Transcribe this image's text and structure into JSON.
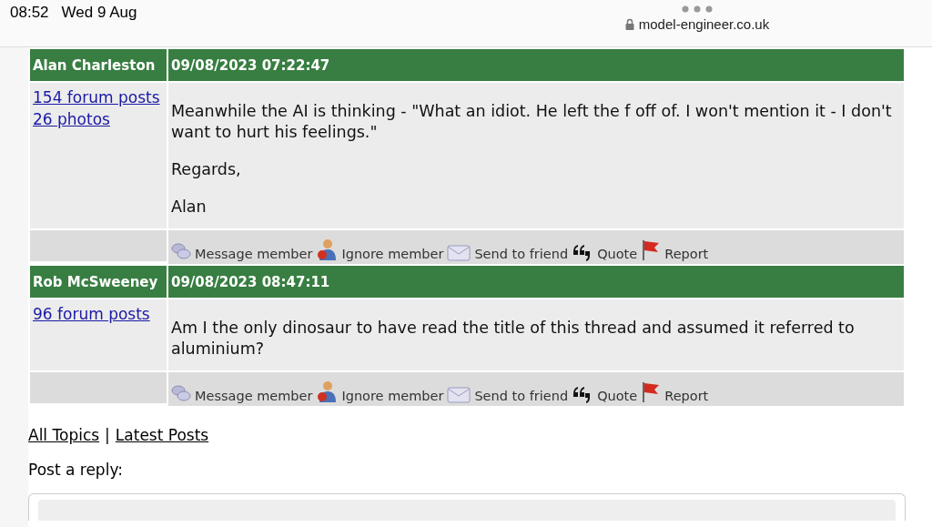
{
  "status_bar": {
    "time": "08:52",
    "date": "Wed 9 Aug"
  },
  "address_bar": {
    "url": "model-engineer.co.uk"
  },
  "posts": [
    {
      "author": "Alan Charleston",
      "timestamp": "09/08/2023 07:22:47",
      "stats": [
        "154 forum posts",
        "26 photos"
      ],
      "paragraphs": [
        "Meanwhile the AI is thinking - \"What an idiot. He left the f off of. I won't mention it - I don't want to hurt his feelings.\"",
        "Regards,",
        "Alan"
      ],
      "actions": [
        {
          "kind": "message",
          "label": "Message member"
        },
        {
          "kind": "ignore",
          "label": "Ignore member"
        },
        {
          "kind": "send",
          "label": "Send to friend"
        },
        {
          "kind": "quote",
          "label": "Quote"
        },
        {
          "kind": "report",
          "label": "Report"
        }
      ]
    },
    {
      "author": "Rob McSweeney",
      "timestamp": "09/08/2023 08:47:11",
      "stats": [
        "96 forum posts"
      ],
      "paragraphs": [
        "Am I the only dinosaur to have read the title of this thread and assumed it referred to aluminium?"
      ],
      "actions": [
        {
          "kind": "message",
          "label": "Message member"
        },
        {
          "kind": "ignore",
          "label": "Ignore member"
        },
        {
          "kind": "send",
          "label": "Send to friend"
        },
        {
          "kind": "quote",
          "label": "Quote"
        },
        {
          "kind": "report",
          "label": "Report"
        }
      ]
    }
  ],
  "nav_links": [
    "All Topics",
    "Latest Posts"
  ],
  "nav_separator": "|",
  "reply_heading": "Post a reply:"
}
